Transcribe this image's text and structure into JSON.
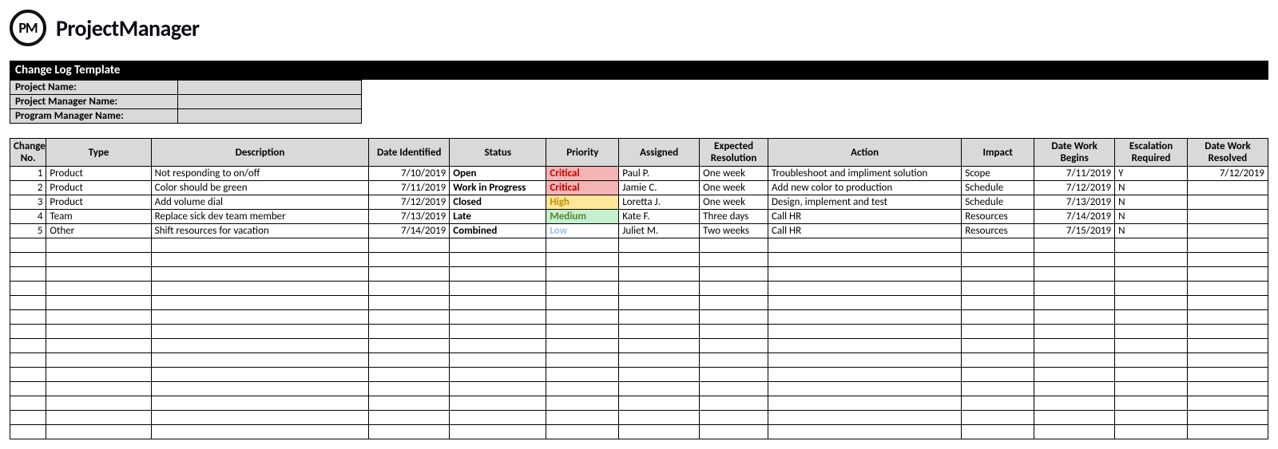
{
  "brand": {
    "logo_text": "PM",
    "name": "ProjectManager"
  },
  "title": "Change Log Template",
  "info": {
    "project_name_label": "Project Name:",
    "project_name_value": "",
    "pm_name_label": "Project Manager Name:",
    "pm_name_value": "",
    "prog_name_label": "Program Manager Name:",
    "prog_name_value": ""
  },
  "headers": {
    "no": "Change No.",
    "type": "Type",
    "desc": "Description",
    "date_id": "Date Identified",
    "status": "Status",
    "priority": "Priority",
    "assigned": "Assigned",
    "exp_res": "Expected Resolution",
    "action": "Action",
    "impact": "Impact",
    "dwb": "Date Work Begins",
    "esc": "Escalation Required",
    "dwr": "Date Work Resolved"
  },
  "rows": [
    {
      "no": "1",
      "type": "Product",
      "desc": "Not responding to on/off",
      "date_id": "7/10/2019",
      "status": "Open",
      "priority": "Critical",
      "pri_class": "pri-critical",
      "assigned": "Paul P.",
      "exp_res": "One week",
      "action": "Troubleshoot and impliment solution",
      "impact": "Scope",
      "dwb": "7/11/2019",
      "esc": "Y",
      "dwr": "7/12/2019"
    },
    {
      "no": "2",
      "type": "Product",
      "desc": "Color should be green",
      "date_id": "7/11/2019",
      "status": "Work in Progress",
      "priority": "Critical",
      "pri_class": "pri-critical",
      "assigned": "Jamie C.",
      "exp_res": "One week",
      "action": "Add new color to production",
      "impact": "Schedule",
      "dwb": "7/12/2019",
      "esc": "N",
      "dwr": ""
    },
    {
      "no": "3",
      "type": "Product",
      "desc": "Add volume dial",
      "date_id": "7/12/2019",
      "status": "Closed",
      "priority": "High",
      "pri_class": "pri-high",
      "assigned": "Loretta J.",
      "exp_res": "One week",
      "action": "Design, implement and test",
      "impact": "Schedule",
      "dwb": "7/13/2019",
      "esc": "N",
      "dwr": ""
    },
    {
      "no": "4",
      "type": "Team",
      "desc": "Replace sick dev team member",
      "date_id": "7/13/2019",
      "status": "Late",
      "priority": "Medium",
      "pri_class": "pri-medium",
      "assigned": "Kate F.",
      "exp_res": "Three days",
      "action": "Call HR",
      "impact": "Resources",
      "dwb": "7/14/2019",
      "esc": "N",
      "dwr": ""
    },
    {
      "no": "5",
      "type": "Other",
      "desc": "Shift resources for vacation",
      "date_id": "7/14/2019",
      "status": "Combined",
      "priority": "Low",
      "pri_class": "pri-low",
      "assigned": "Juliet M.",
      "exp_res": "Two weeks",
      "action": "Call HR",
      "impact": "Resources",
      "dwb": "7/15/2019",
      "esc": "N",
      "dwr": ""
    }
  ],
  "empty_row_count": 14
}
